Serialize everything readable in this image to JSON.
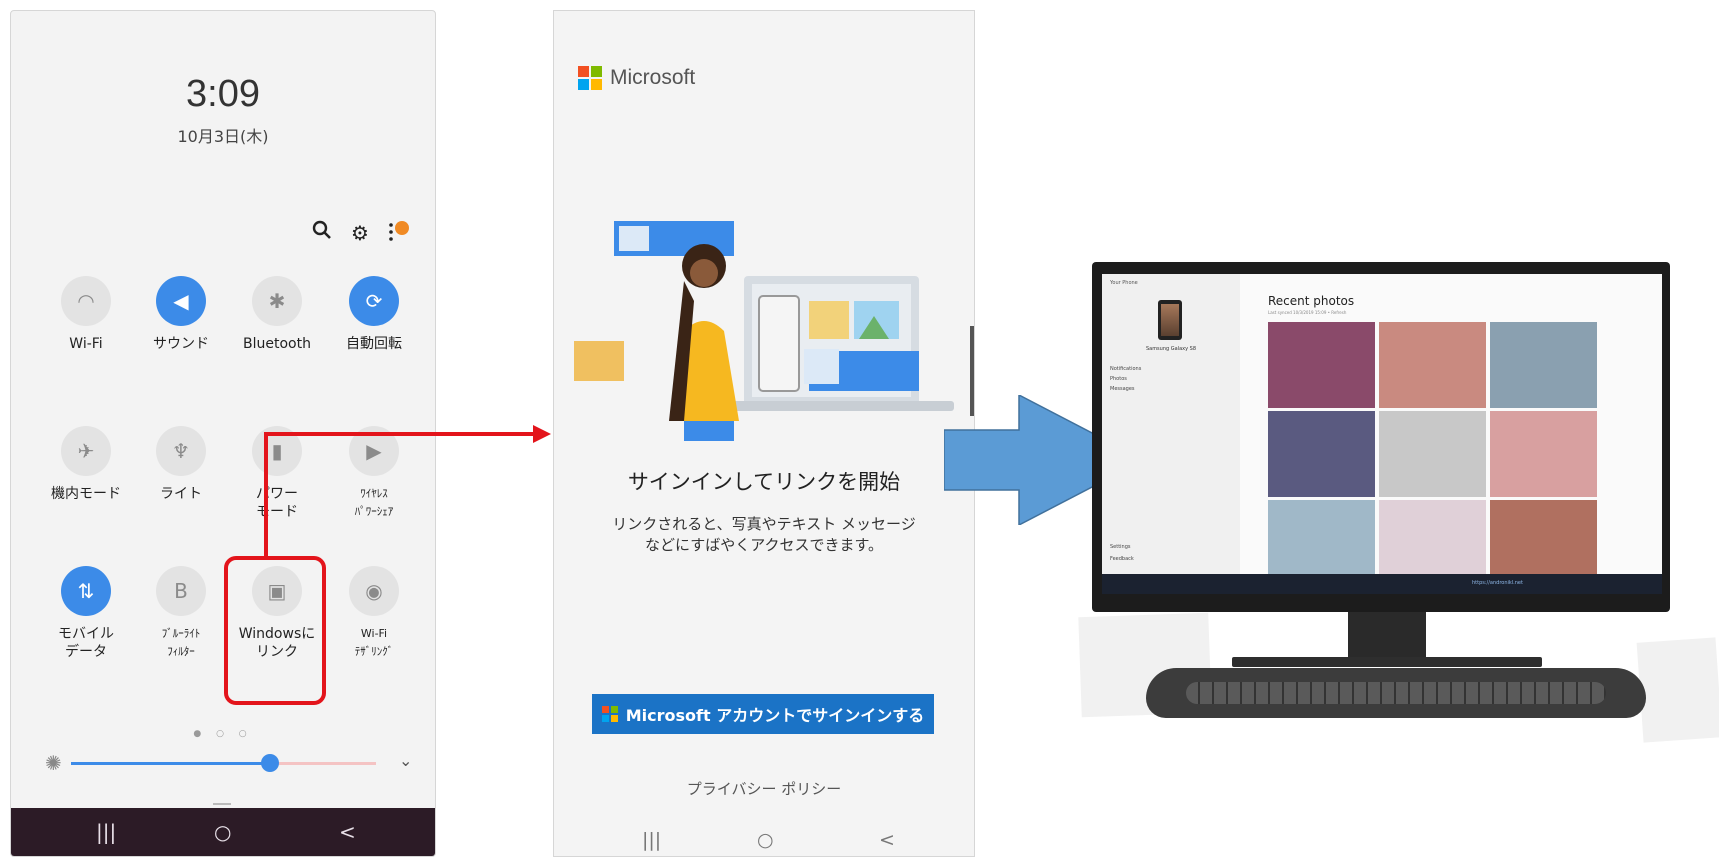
{
  "phone1": {
    "time": "3:09",
    "date": "10月3日(木)",
    "top_icons": [
      "search-icon",
      "settings-icon",
      "more-icon"
    ],
    "tiles": [
      {
        "label": "Wi-Fi",
        "icon": "wifi-icon",
        "on": false
      },
      {
        "label": "サウンド",
        "icon": "sound-icon",
        "on": true
      },
      {
        "label": "Bluetooth",
        "icon": "bluetooth-icon",
        "on": false
      },
      {
        "label": "自動回転",
        "icon": "rotate-icon",
        "on": true
      },
      {
        "label": "機内モード",
        "icon": "airplane-icon",
        "on": false
      },
      {
        "label": "ライト",
        "icon": "flashlight-icon",
        "on": false
      },
      {
        "label": "パワー\nモード",
        "icon": "battery-icon",
        "on": false
      },
      {
        "label": "ﾜｲﾔﾚｽ\nﾊﾟﾜｰｼｪｱ",
        "icon": "wireless-share-icon",
        "on": false
      },
      {
        "label": "モバイル\nデータ",
        "icon": "mobile-data-icon",
        "on": true
      },
      {
        "label": "ﾌﾞﾙｰﾗｲﾄ\nﾌｨﾙﾀｰ",
        "icon": "blue-light-icon",
        "on": false
      },
      {
        "label": "Windowsに\nリンク",
        "icon": "link-to-windows-icon",
        "on": false
      },
      {
        "label": "Wi-Fi\nﾃｻﾞﾘﾝｸﾞ",
        "icon": "hotspot-icon",
        "on": false
      }
    ],
    "brightness": 0.66,
    "nav": [
      "|||",
      "○",
      "<"
    ]
  },
  "phone2": {
    "brand": "Microsoft",
    "title": "サインインしてリンクを開始",
    "description": "リンクされると、写真やテキスト メッセージ\nなどにすばやくアクセスできます。",
    "signin_button": "Microsoft アカウントでサインインする",
    "privacy": "プライバシー ポリシー",
    "nav": [
      "|||",
      "○",
      "<"
    ]
  },
  "pc_app": {
    "app_title": "Your Phone",
    "device": "Samsung Galaxy S8",
    "nav_items": [
      "Notifications",
      "Photos",
      "Messages"
    ],
    "bottom_items": [
      "Settings",
      "Feedback"
    ],
    "section_title": "Recent photos",
    "subtitle": "Last synced 10/3/2019 15:09 • Refresh",
    "taskbar_text": "https://andronikl.net"
  },
  "colors": {
    "accent_blue": "#3c8be8",
    "ms_blue": "#1b73c6",
    "highlight_red": "#e3141b",
    "big_arrow": "#5b9bd5",
    "nav_bar": "#2c1b26"
  }
}
